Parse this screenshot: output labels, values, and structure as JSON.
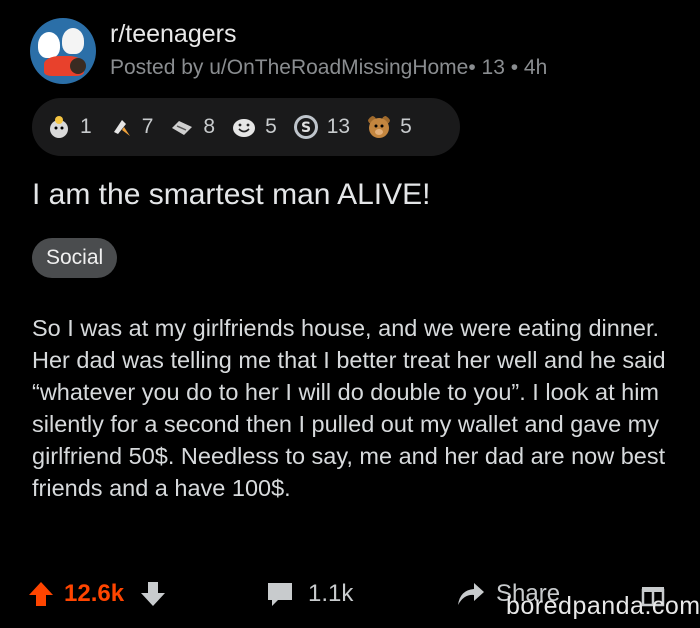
{
  "post": {
    "subreddit": "r/teenagers",
    "posted_by": "Posted by u/OnTheRoadMissingHome",
    "meta_suffix": "• 13 • 4h",
    "title": "I am the smartest man ALIVE!",
    "flair": "Social",
    "body": "So I was at my girlfriends house, and we were eating dinner. Her dad was telling me that I better treat her well and he said “whatever you do to her I will do double to you”. I look at him silently for a second then I pulled out my wallet and gave my girlfriend 50$. Needless to say, me and her dad are now best friends and a have 100$."
  },
  "awards": [
    {
      "icon": "wholesome-award-icon",
      "count": "1",
      "color": "#d9d9d9"
    },
    {
      "icon": "rocket-like-award-icon",
      "count": "7",
      "color": "#f0a23a"
    },
    {
      "icon": "handshake-award-icon",
      "count": "8",
      "color": "#cfcfcf"
    },
    {
      "icon": "laughing-face-award-icon",
      "count": "5",
      "color": "#e6e6e6"
    },
    {
      "icon": "silver-award-icon",
      "count": "13",
      "color": "#bfc5cc"
    },
    {
      "icon": "bear-award-icon",
      "count": "5",
      "color": "#c4863f"
    }
  ],
  "actions": {
    "upvote_count": "12.6k",
    "comment_count": "1.1k",
    "share_label": "Share",
    "upvote_color": "#ff4500"
  },
  "watermark": "boredpanda.com"
}
